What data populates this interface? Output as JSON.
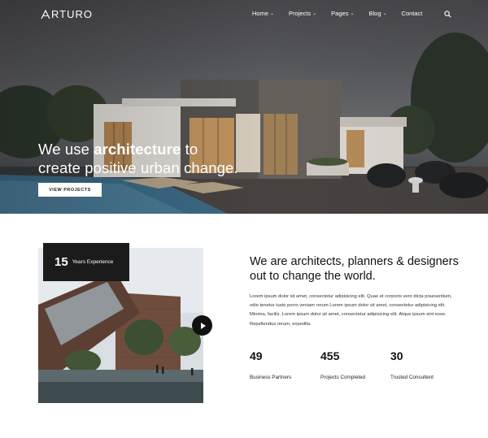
{
  "brand": {
    "logo_text": "RTURO",
    "logo_initial_icon": "a-logo-icon"
  },
  "nav": {
    "items": [
      {
        "label": "Home",
        "has_dropdown": true
      },
      {
        "label": "Projects",
        "has_dropdown": true
      },
      {
        "label": "Pages",
        "has_dropdown": true
      },
      {
        "label": "Blog",
        "has_dropdown": true
      },
      {
        "label": "Contact",
        "has_dropdown": false
      }
    ],
    "chevron": "⌄",
    "search_icon": "search-icon"
  },
  "hero": {
    "headline_pre": "We use ",
    "headline_bold": "architecture",
    "headline_post": " to",
    "headline_line2": "create positive urban change.",
    "cta_label": "VIEW PROJECTS"
  },
  "experience": {
    "number": "15",
    "label": "Years Experience"
  },
  "video": {
    "icon": "play-icon"
  },
  "about": {
    "title": "We are architects, planners & designers out to change the world.",
    "body": "Lorem ipsum dolor sit amet, consectetur adipisicing elit. Quae et corporis vero dicta praesentium, odio tenetur iusto porro veniam rerum Lorem ipsum dolor sit amet, consectetur adipisicing elit. Minima, facilis. Lorem ipsum dolor sit amet, consectetur adipisicing elit. Atque ipsum sint esse. Repellendus rerum, expedita."
  },
  "stats": [
    {
      "number": "49",
      "label": "Business Partners"
    },
    {
      "number": "455",
      "label": "Projects Completed"
    },
    {
      "number": "30",
      "label": "Trusted Consultent"
    }
  ],
  "colors": {
    "dark": "#1b1b1b",
    "white": "#ffffff",
    "text": "#111111"
  }
}
